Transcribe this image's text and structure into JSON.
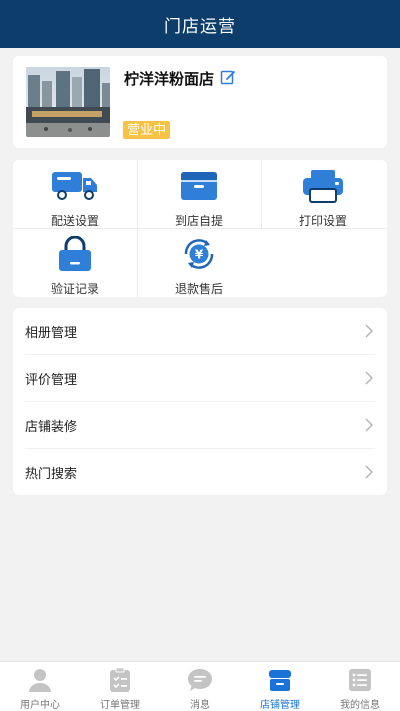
{
  "header": {
    "title": "门店运营"
  },
  "store": {
    "name": "柠洋洋粉面店",
    "status": "营业中"
  },
  "features": [
    {
      "label": "配送设置",
      "icon": "delivery-truck-icon"
    },
    {
      "label": "到店自提",
      "icon": "box-icon"
    },
    {
      "label": "打印设置",
      "icon": "printer-icon"
    },
    {
      "label": "验证记录",
      "icon": "lock-icon"
    },
    {
      "label": "退款售后",
      "icon": "refund-yen-icon"
    }
  ],
  "menu": [
    {
      "label": "相册管理"
    },
    {
      "label": "评价管理"
    },
    {
      "label": "店铺装修"
    },
    {
      "label": "热门搜索"
    }
  ],
  "tabs": [
    {
      "label": "用户中心",
      "icon": "user-icon"
    },
    {
      "label": "订单管理",
      "icon": "clipboard-icon"
    },
    {
      "label": "消息",
      "icon": "chat-icon"
    },
    {
      "label": "店铺管理",
      "icon": "store-icon"
    },
    {
      "label": "我的信息",
      "icon": "list-icon"
    }
  ],
  "colors": {
    "header": "#0c3d6b",
    "accent": "#1a73d9",
    "badge": "#f8c244"
  },
  "active_tab": 3
}
